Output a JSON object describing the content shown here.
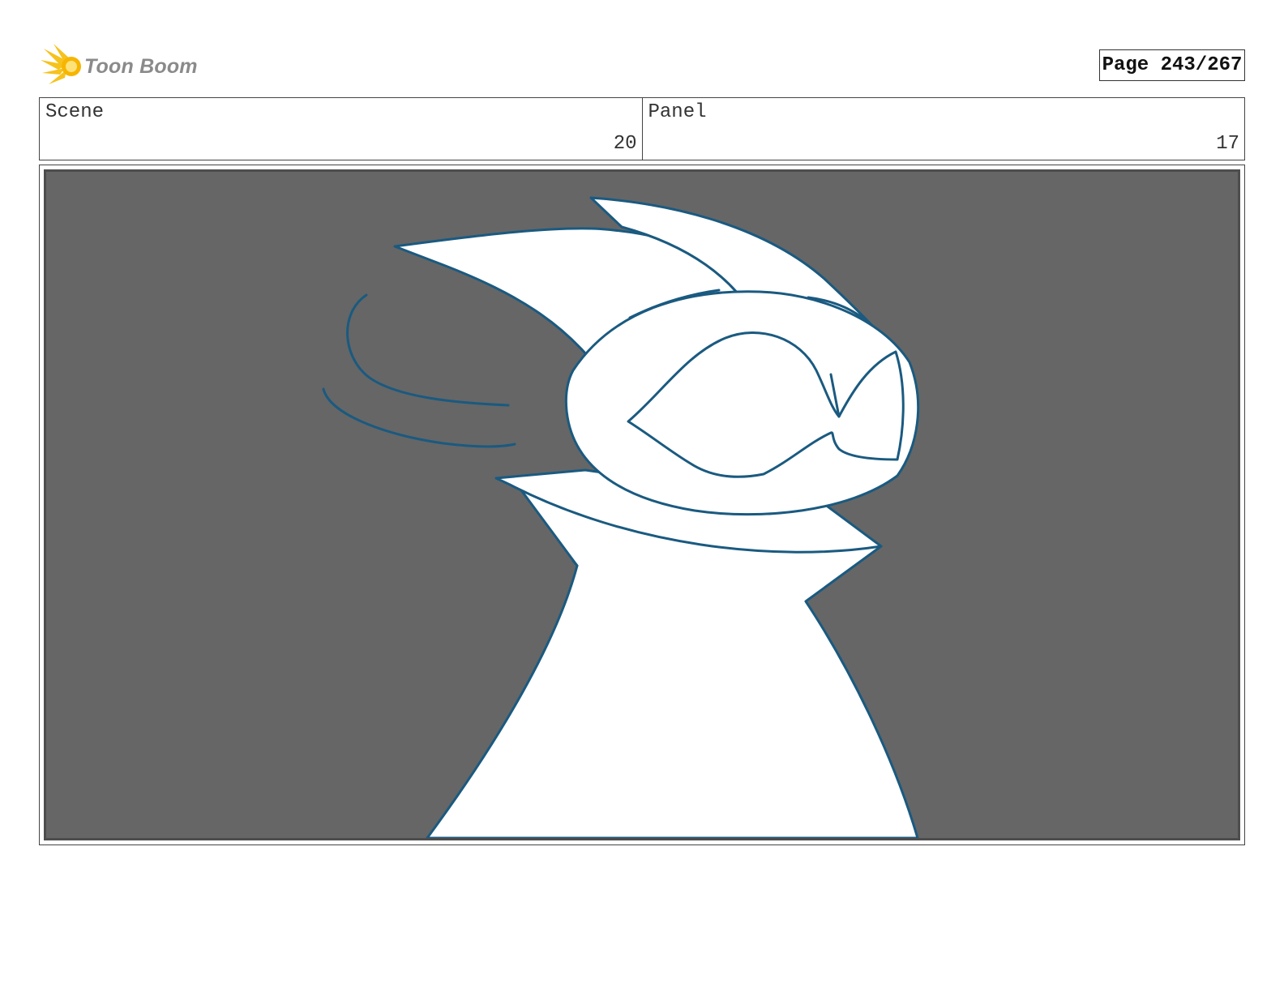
{
  "header": {
    "logo_text": "Toon Boom",
    "page_label": "Page 243/267"
  },
  "info": {
    "scene_label": "Scene",
    "scene_value": "20",
    "panel_label": "Panel",
    "panel_value": "17"
  },
  "colors": {
    "background": "#666666",
    "line": "#1a5a80",
    "fill": "#ffffff"
  }
}
